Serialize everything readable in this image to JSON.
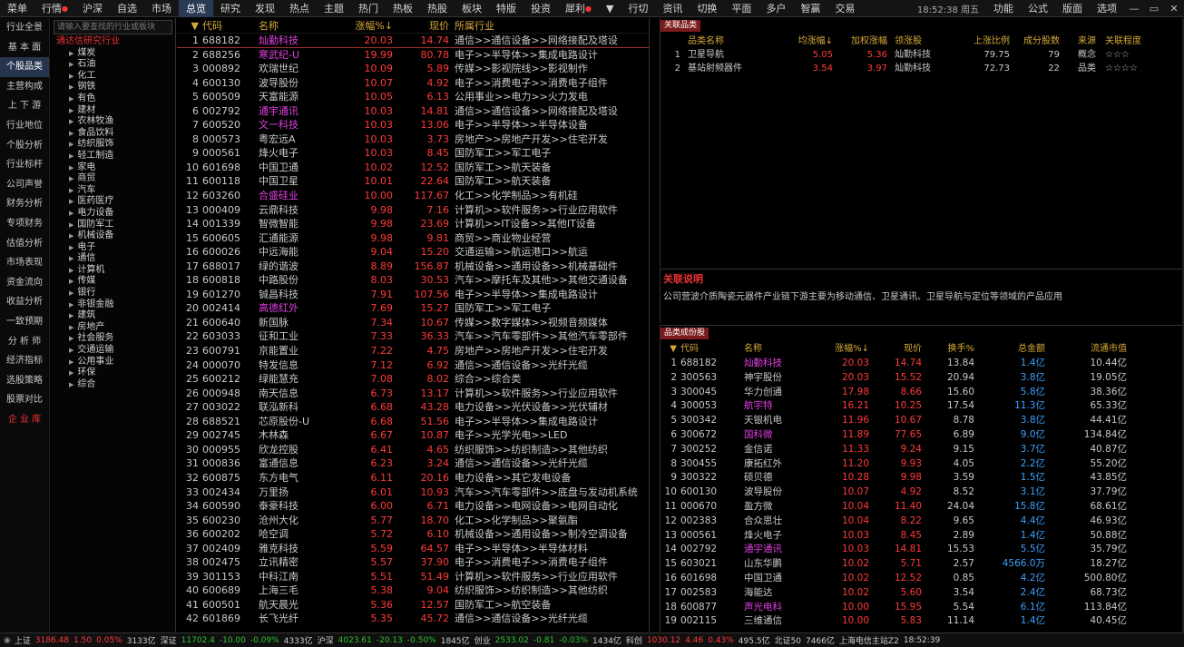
{
  "topbar": {
    "menus": [
      "菜单",
      "行情",
      "沪深",
      "自选",
      "市场",
      "总览",
      "研究",
      "发现",
      "热点",
      "主题",
      "热门",
      "热板",
      "热股",
      "板块",
      "特版",
      "投资",
      "犀利",
      "▼",
      "行切",
      "资讯",
      "切换",
      "平面",
      "多户",
      "智赢",
      "交易"
    ],
    "active": "总览",
    "dotted": [
      "行情",
      "犀利"
    ],
    "clock": "18:52:38 周五",
    "right_menus": [
      "功能",
      "公式",
      "版面",
      "选项"
    ],
    "win_buttons": [
      "—",
      "▭",
      "✕"
    ]
  },
  "leftnav": {
    "items": [
      "行业全景",
      "基 本 面",
      "个股品类",
      "主营构成",
      "上 下 游",
      "行业地位",
      "个股分析",
      "行业标杆",
      "公司声誉",
      "财务分析",
      "专项财务",
      "估值分析",
      "市场表现",
      "资金流向",
      "收益分析",
      "一致预期",
      "分 析 师",
      "经济指标",
      "选股策略",
      "股票对比",
      "企 业 库"
    ],
    "active": "个股品类",
    "red": "企 业 库"
  },
  "tree": {
    "search_placeholder": "请输入要查找的行业或板块",
    "root": "通达信研究行业",
    "nodes": [
      "煤炭",
      "石油",
      "化工",
      "钢铁",
      "有色",
      "建材",
      "农林牧渔",
      "食品饮料",
      "纺织服饰",
      "轻工制造",
      "家电",
      "商贸",
      "汽车",
      "医药医疗",
      "电力设备",
      "国防军工",
      "机械设备",
      "电子",
      "通信",
      "计算机",
      "传媒",
      "银行",
      "非银金融",
      "建筑",
      "房地产",
      "社会服务",
      "交通运输",
      "公用事业",
      "环保",
      "综合"
    ]
  },
  "main": {
    "headers": {
      "idx": "▼",
      "code": "代码",
      "name": "名称",
      "pct": "涨幅%↓",
      "price": "现价",
      "industry": "所属行业"
    },
    "rows": [
      {
        "i": "1",
        "code": "688182",
        "name": "灿勤科技",
        "pct": "20.03",
        "price": "14.74",
        "ind": "通信>>通信设备>>网络接配及塔设",
        "color": "#e040e0",
        "sel": true
      },
      {
        "i": "2",
        "code": "688256",
        "name": "寒武纪-U",
        "pct": "19.99",
        "price": "80.78",
        "ind": "电子>>半导体>>集成电路设计",
        "color": "#e040e0"
      },
      {
        "i": "3",
        "code": "000892",
        "name": "欢瑞世纪",
        "pct": "10.09",
        "price": "5.89",
        "ind": "传媒>>影视院线>>影视制作",
        "color": "#c8c8c8"
      },
      {
        "i": "4",
        "code": "600130",
        "name": "波导股份",
        "pct": "10.07",
        "price": "4.92",
        "ind": "电子>>消费电子>>消费电子组件",
        "color": "#c8c8c8"
      },
      {
        "i": "5",
        "code": "600509",
        "name": "天富能源",
        "pct": "10.05",
        "price": "6.13",
        "ind": "公用事业>>电力>>火力发电",
        "color": "#c8c8c8"
      },
      {
        "i": "6",
        "code": "002792",
        "name": "通宇通讯",
        "pct": "10.03",
        "price": "14.81",
        "ind": "通信>>通信设备>>网络接配及塔设",
        "color": "#e040e0"
      },
      {
        "i": "7",
        "code": "600520",
        "name": "文一科技",
        "pct": "10.03",
        "price": "13.06",
        "ind": "电子>>半导体>>半导体设备",
        "color": "#e040e0"
      },
      {
        "i": "8",
        "code": "000573",
        "name": "粤宏远A",
        "pct": "10.03",
        "price": "3.73",
        "ind": "房地产>>房地产开发>>住宅开发",
        "color": "#c8c8c8"
      },
      {
        "i": "9",
        "code": "000561",
        "name": "烽火电子",
        "pct": "10.03",
        "price": "8.45",
        "ind": "国防军工>>军工电子",
        "color": "#c8c8c8"
      },
      {
        "i": "10",
        "code": "601698",
        "name": "中国卫通",
        "pct": "10.02",
        "price": "12.52",
        "ind": "国防军工>>航天装备",
        "color": "#c8c8c8"
      },
      {
        "i": "11",
        "code": "600118",
        "name": "中国卫星",
        "pct": "10.01",
        "price": "22.64",
        "ind": "国防军工>>航天装备",
        "color": "#c8c8c8"
      },
      {
        "i": "12",
        "code": "603260",
        "name": "合盛硅业",
        "pct": "10.00",
        "price": "117.67",
        "ind": "化工>>化学制品>>有机硅",
        "color": "#e040e0"
      },
      {
        "i": "13",
        "code": "000409",
        "name": "云鼎科技",
        "pct": "9.98",
        "price": "7.16",
        "ind": "计算机>>软件服务>>行业应用软件",
        "color": "#c8c8c8"
      },
      {
        "i": "14",
        "code": "001339",
        "name": "智微智能",
        "pct": "9.98",
        "price": "23.69",
        "ind": "计算机>>IT设备>>其他IT设备",
        "color": "#c8c8c8"
      },
      {
        "i": "15",
        "code": "600605",
        "name": "汇通能源",
        "pct": "9.98",
        "price": "9.81",
        "ind": "商贸>>商业物业经营",
        "color": "#c8c8c8"
      },
      {
        "i": "16",
        "code": "600026",
        "name": "中远海能",
        "pct": "9.04",
        "price": "15.20",
        "ind": "交通运输>>航运港口>>航运",
        "color": "#c8c8c8"
      },
      {
        "i": "17",
        "code": "688017",
        "name": "绿的谐波",
        "pct": "8.89",
        "price": "156.87",
        "ind": "机械设备>>通用设备>>机械基础件",
        "color": "#c8c8c8"
      },
      {
        "i": "18",
        "code": "600818",
        "name": "中路股份",
        "pct": "8.03",
        "price": "30.53",
        "ind": "汽车>>摩托车及其他>>其他交通设备",
        "color": "#c8c8c8"
      },
      {
        "i": "19",
        "code": "601270",
        "name": "铖昌科技",
        "pct": "7.91",
        "price": "107.56",
        "ind": "电子>>半导体>>集成电路设计",
        "color": "#c8c8c8"
      },
      {
        "i": "20",
        "code": "002414",
        "name": "高德红外",
        "pct": "7.69",
        "price": "15.27",
        "ind": "国防军工>>军工电子",
        "color": "#e040e0"
      },
      {
        "i": "21",
        "code": "600640",
        "name": "新国脉",
        "pct": "7.34",
        "price": "10.67",
        "ind": "传媒>>数字媒体>>视频音频媒体",
        "color": "#c8c8c8"
      },
      {
        "i": "22",
        "code": "603033",
        "name": "征和工业",
        "pct": "7.33",
        "price": "36.33",
        "ind": "汽车>>汽车零部件>>其他汽车零部件",
        "color": "#c8c8c8"
      },
      {
        "i": "23",
        "code": "600791",
        "name": "京能置业",
        "pct": "7.22",
        "price": "4.75",
        "ind": "房地产>>房地产开发>>住宅开发",
        "color": "#c8c8c8"
      },
      {
        "i": "24",
        "code": "000070",
        "name": "特发信息",
        "pct": "7.12",
        "price": "6.92",
        "ind": "通信>>通信设备>>光纤光缆",
        "color": "#c8c8c8"
      },
      {
        "i": "25",
        "code": "600212",
        "name": "绿能慧充",
        "pct": "7.08",
        "price": "8.02",
        "ind": "综合>>综合类",
        "color": "#c8c8c8"
      },
      {
        "i": "26",
        "code": "000948",
        "name": "南天信息",
        "pct": "6.73",
        "price": "13.17",
        "ind": "计算机>>软件服务>>行业应用软件",
        "color": "#c8c8c8"
      },
      {
        "i": "27",
        "code": "003022",
        "name": "联泓新科",
        "pct": "6.68",
        "price": "43.28",
        "ind": "电力设备>>光伏设备>>光伏辅材",
        "color": "#c8c8c8"
      },
      {
        "i": "28",
        "code": "688521",
        "name": "芯原股份-U",
        "pct": "6.68",
        "price": "51.56",
        "ind": "电子>>半导体>>集成电路设计",
        "color": "#c8c8c8"
      },
      {
        "i": "29",
        "code": "002745",
        "name": "木林森",
        "pct": "6.67",
        "price": "10.87",
        "ind": "电子>>光学光电>>LED",
        "color": "#c8c8c8"
      },
      {
        "i": "30",
        "code": "000955",
        "name": "欣龙控股",
        "pct": "6.41",
        "price": "4.65",
        "ind": "纺织服饰>>纺织制造>>其他纺织",
        "color": "#c8c8c8"
      },
      {
        "i": "31",
        "code": "000836",
        "name": "富通信息",
        "pct": "6.23",
        "price": "3.24",
        "ind": "通信>>通信设备>>光纤光缆",
        "color": "#c8c8c8"
      },
      {
        "i": "32",
        "code": "600875",
        "name": "东方电气",
        "pct": "6.11",
        "price": "20.16",
        "ind": "电力设备>>其它发电设备",
        "color": "#c8c8c8"
      },
      {
        "i": "33",
        "code": "002434",
        "name": "万里扬",
        "pct": "6.01",
        "price": "10.93",
        "ind": "汽车>>汽车零部件>>底盘与发动机系统",
        "color": "#c8c8c8"
      },
      {
        "i": "34",
        "code": "600590",
        "name": "泰豪科技",
        "pct": "6.00",
        "price": "6.71",
        "ind": "电力设备>>电网设备>>电网自动化",
        "color": "#c8c8c8"
      },
      {
        "i": "35",
        "code": "600230",
        "name": "沧州大化",
        "pct": "5.77",
        "price": "18.70",
        "ind": "化工>>化学制品>>聚氨酯",
        "color": "#c8c8c8"
      },
      {
        "i": "36",
        "code": "600202",
        "name": "哈空调",
        "pct": "5.72",
        "price": "6.10",
        "ind": "机械设备>>通用设备>>制冷空调设备",
        "color": "#c8c8c8"
      },
      {
        "i": "37",
        "code": "002409",
        "name": "雅克科技",
        "pct": "5.59",
        "price": "64.57",
        "ind": "电子>>半导体>>半导体材料",
        "color": "#c8c8c8"
      },
      {
        "i": "38",
        "code": "002475",
        "name": "立讯精密",
        "pct": "5.57",
        "price": "37.90",
        "ind": "电子>>消费电子>>消费电子组件",
        "color": "#c8c8c8"
      },
      {
        "i": "39",
        "code": "301153",
        "name": "中科江南",
        "pct": "5.51",
        "price": "51.49",
        "ind": "计算机>>软件服务>>行业应用软件",
        "color": "#c8c8c8"
      },
      {
        "i": "40",
        "code": "600689",
        "name": "上海三毛",
        "pct": "5.38",
        "price": "9.04",
        "ind": "纺织服饰>>纺织制造>>其他纺织",
        "color": "#c8c8c8"
      },
      {
        "i": "41",
        "code": "600501",
        "name": "航天晨光",
        "pct": "5.36",
        "price": "12.57",
        "ind": "国防军工>>航空装备",
        "color": "#c8c8c8"
      },
      {
        "i": "42",
        "code": "601869",
        "name": "长飞光纤",
        "pct": "5.35",
        "price": "45.72",
        "ind": "通信>>通信设备>>光纤光缆",
        "color": "#c8c8c8"
      }
    ]
  },
  "related": {
    "tag": "关联品类",
    "headers": {
      "name": "品类名称",
      "avg": "均涨幅↓",
      "wavg": "加权涨幅",
      "lead": "领涨股",
      "ratio": "上涨比例",
      "count": "成分股数",
      "src": "来源",
      "level": "关联程度"
    },
    "rows": [
      {
        "i": "1",
        "name": "卫星导航",
        "avg": "5.05",
        "wavg": "5.36",
        "lead": "灿勤科技",
        "ratio": "79.75",
        "count": "79",
        "src": "概念",
        "level": "☆☆☆"
      },
      {
        "i": "2",
        "name": "基站射频器件",
        "avg": "3.54",
        "wavg": "3.97",
        "lead": "灿勤科技",
        "ratio": "72.73",
        "count": "22",
        "src": "品类",
        "level": "☆☆☆☆"
      }
    ]
  },
  "explain": {
    "title": "关联说明",
    "text": "公司营波介质陶瓷元器件产业链下游主要为移动通信、卫星通讯、卫星导航与定位等领域的产品应用"
  },
  "components": {
    "tag": "品类成份股",
    "headers": {
      "idx": "▼",
      "code": "代码",
      "name": "名称",
      "pct": "涨幅%↓",
      "price": "现价",
      "turn": "换手%",
      "amt": "总金额",
      "mv": "流通市值"
    },
    "rows": [
      {
        "i": "1",
        "code": "688182",
        "name": "灿勤科技",
        "pct": "20.03",
        "price": "14.74",
        "turn": "13.84",
        "amt": "1.4亿",
        "mv": "10.44亿",
        "color": "#e040e0"
      },
      {
        "i": "2",
        "code": "300563",
        "name": "神宇股份",
        "pct": "20.03",
        "price": "15.52",
        "turn": "20.94",
        "amt": "3.8亿",
        "mv": "19.05亿",
        "color": "#c8c8c8"
      },
      {
        "i": "3",
        "code": "300045",
        "name": "华力创通",
        "pct": "17.98",
        "price": "8.66",
        "turn": "15.60",
        "amt": "5.8亿",
        "mv": "38.36亿",
        "color": "#c8c8c8"
      },
      {
        "i": "4",
        "code": "300053",
        "name": "航宇特",
        "pct": "16.21",
        "price": "10.25",
        "turn": "17.54",
        "amt": "11.3亿",
        "mv": "65.33亿",
        "color": "#e040e0"
      },
      {
        "i": "5",
        "code": "300342",
        "name": "天银机电",
        "pct": "11.96",
        "price": "10.67",
        "turn": "8.78",
        "amt": "3.8亿",
        "mv": "44.41亿",
        "color": "#c8c8c8"
      },
      {
        "i": "6",
        "code": "300672",
        "name": "国科微",
        "pct": "11.89",
        "price": "77.65",
        "turn": "6.89",
        "amt": "9.0亿",
        "mv": "134.84亿",
        "color": "#e040e0"
      },
      {
        "i": "7",
        "code": "300252",
        "name": "金信诺",
        "pct": "11.33",
        "price": "9.24",
        "turn": "9.15",
        "amt": "3.7亿",
        "mv": "40.87亿",
        "color": "#c8c8c8"
      },
      {
        "i": "8",
        "code": "300455",
        "name": "康拓红外",
        "pct": "11.20",
        "price": "9.93",
        "turn": "4.05",
        "amt": "2.2亿",
        "mv": "55.20亿",
        "color": "#c8c8c8"
      },
      {
        "i": "9",
        "code": "300322",
        "name": "硕贝德",
        "pct": "10.28",
        "price": "9.98",
        "turn": "3.59",
        "amt": "1.5亿",
        "mv": "43.85亿",
        "color": "#c8c8c8"
      },
      {
        "i": "10",
        "code": "600130",
        "name": "波导股份",
        "pct": "10.07",
        "price": "4.92",
        "turn": "8.52",
        "amt": "3.1亿",
        "mv": "37.79亿",
        "color": "#c8c8c8"
      },
      {
        "i": "11",
        "code": "000670",
        "name": "盈方微",
        "pct": "10.04",
        "price": "11.40",
        "turn": "24.04",
        "amt": "15.8亿",
        "mv": "68.61亿",
        "color": "#c8c8c8"
      },
      {
        "i": "12",
        "code": "002383",
        "name": "合众思壮",
        "pct": "10.04",
        "price": "8.22",
        "turn": "9.65",
        "amt": "4.4亿",
        "mv": "46.93亿",
        "color": "#c8c8c8"
      },
      {
        "i": "13",
        "code": "000561",
        "name": "烽火电子",
        "pct": "10.03",
        "price": "8.45",
        "turn": "2.89",
        "amt": "1.4亿",
        "mv": "50.88亿",
        "color": "#c8c8c8"
      },
      {
        "i": "14",
        "code": "002792",
        "name": "通宇通讯",
        "pct": "10.03",
        "price": "14.81",
        "turn": "15.53",
        "amt": "5.5亿",
        "mv": "35.79亿",
        "color": "#e040e0"
      },
      {
        "i": "15",
        "code": "603021",
        "name": "山东华鹏",
        "pct": "10.02",
        "price": "5.71",
        "turn": "2.57",
        "amt": "4566.0万",
        "mv": "18.27亿",
        "color": "#c8c8c8"
      },
      {
        "i": "16",
        "code": "601698",
        "name": "中国卫通",
        "pct": "10.02",
        "price": "12.52",
        "turn": "0.85",
        "amt": "4.2亿",
        "mv": "500.80亿",
        "color": "#c8c8c8"
      },
      {
        "i": "17",
        "code": "002583",
        "name": "海能达",
        "pct": "10.02",
        "price": "5.60",
        "turn": "3.54",
        "amt": "2.4亿",
        "mv": "68.73亿",
        "color": "#c8c8c8"
      },
      {
        "i": "18",
        "code": "600877",
        "name": "声光电科",
        "pct": "10.00",
        "price": "15.95",
        "turn": "5.54",
        "amt": "6.1亿",
        "mv": "113.84亿",
        "color": "#e040e0"
      },
      {
        "i": "19",
        "code": "002115",
        "name": "三维通信",
        "pct": "10.00",
        "price": "5.83",
        "turn": "11.14",
        "amt": "1.4亿",
        "mv": "40.45亿",
        "color": "#c8c8c8"
      }
    ]
  },
  "status": {
    "items": [
      {
        "t": "上证",
        "c": "w"
      },
      {
        "t": "3186.48",
        "c": "r"
      },
      {
        "t": "1.50",
        "c": "r"
      },
      {
        "t": "0.05%",
        "c": "r"
      },
      {
        "t": "3133亿",
        "c": "w"
      },
      {
        "t": "深证",
        "c": "w"
      },
      {
        "t": "11702.4",
        "c": "g"
      },
      {
        "t": "-10.00",
        "c": "g"
      },
      {
        "t": "-0.09%",
        "c": "g"
      },
      {
        "t": "4333亿",
        "c": "w"
      },
      {
        "t": "沪深",
        "c": "w"
      },
      {
        "t": "4023.61",
        "c": "g"
      },
      {
        "t": "-20.13",
        "c": "g"
      },
      {
        "t": "-0.50%",
        "c": "g"
      },
      {
        "t": "1845亿",
        "c": "w"
      },
      {
        "t": "创业",
        "c": "w"
      },
      {
        "t": "2533.02",
        "c": "g"
      },
      {
        "t": "-0.81",
        "c": "g"
      },
      {
        "t": "-0.03%",
        "c": "g"
      },
      {
        "t": "1434亿",
        "c": "w"
      },
      {
        "t": "科创",
        "c": "w"
      },
      {
        "t": "1030.12",
        "c": "r"
      },
      {
        "t": "4.46",
        "c": "r"
      },
      {
        "t": "0.43%",
        "c": "r"
      },
      {
        "t": "495.5亿",
        "c": "w"
      },
      {
        "t": "北证50",
        "c": "w"
      },
      {
        "t": "7466亿",
        "c": "w"
      },
      {
        "t": "上海电信主站Z2",
        "c": "w"
      },
      {
        "t": "18:52:39",
        "c": "w"
      }
    ]
  }
}
